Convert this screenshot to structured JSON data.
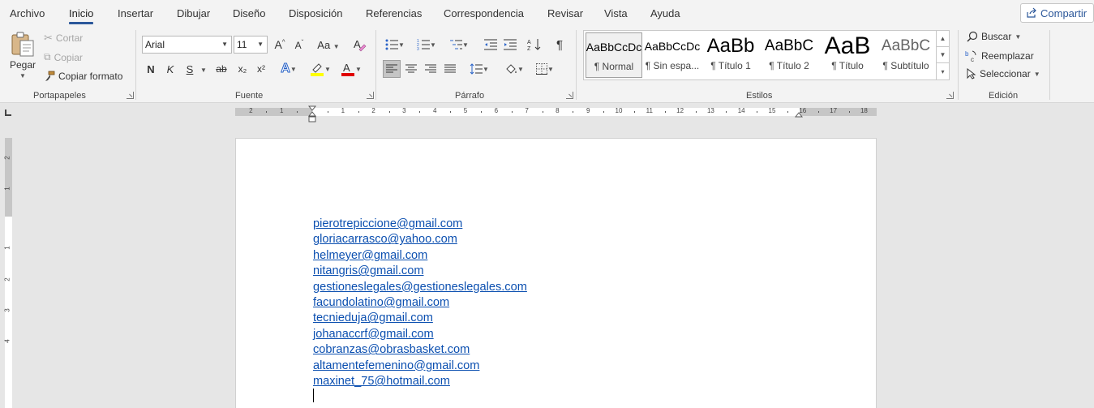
{
  "tabs": [
    {
      "label": "Archivo",
      "active": false
    },
    {
      "label": "Inicio",
      "active": true
    },
    {
      "label": "Insertar",
      "active": false
    },
    {
      "label": "Dibujar",
      "active": false
    },
    {
      "label": "Diseño",
      "active": false
    },
    {
      "label": "Disposición",
      "active": false
    },
    {
      "label": "Referencias",
      "active": false
    },
    {
      "label": "Correspondencia",
      "active": false
    },
    {
      "label": "Revisar",
      "active": false
    },
    {
      "label": "Vista",
      "active": false
    },
    {
      "label": "Ayuda",
      "active": false
    }
  ],
  "share_label": "Compartir",
  "clipboard": {
    "group_label": "Portapapeles",
    "paste": "Pegar",
    "cut": "Cortar",
    "copy": "Copiar",
    "format_painter": "Copiar formato"
  },
  "font": {
    "group_label": "Fuente",
    "font_name": "Arial",
    "font_size": "11",
    "bold": "N",
    "italic": "K",
    "underline": "S",
    "strikethrough": "ab",
    "subscript": "x₂",
    "superscript": "x²",
    "grow": "A^",
    "shrink": "Aˇ",
    "change_case": "Aa",
    "highlight_color": "#ffff00",
    "font_color": "#e00000"
  },
  "paragraph": {
    "group_label": "Párrafo",
    "show_marks": "¶",
    "active_alignment": "left"
  },
  "styles": {
    "group_label": "Estilos",
    "items": [
      {
        "sample": "AaBbCcDc",
        "name": "¶ Normal",
        "selected": true
      },
      {
        "sample": "AaBbCcDc",
        "name": "¶ Sin espa...",
        "selected": false
      },
      {
        "sample": "AaBb",
        "name": "¶ Título 1",
        "selected": false
      },
      {
        "sample": "AaBbC",
        "name": "¶ Título 2",
        "selected": false
      },
      {
        "sample": "AaB",
        "name": "¶ Título",
        "selected": false
      },
      {
        "sample": "AaBbC",
        "name": "¶ Subtítulo",
        "selected": false
      }
    ]
  },
  "editing": {
    "group_label": "Edición",
    "find": "Buscar",
    "replace": "Reemplazar",
    "select": "Seleccionar"
  },
  "ruler": {
    "left_numbers": [
      "2",
      "1"
    ],
    "right_numbers": [
      "1",
      "2",
      "3",
      "4",
      "5",
      "6",
      "7",
      "8",
      "9",
      "10",
      "11",
      "12",
      "13",
      "14",
      "15",
      "16",
      "17",
      "18"
    ],
    "vertical_numbers": [
      "2",
      "1",
      "1",
      "2",
      "3",
      "4"
    ]
  },
  "document": {
    "emails": [
      "pierotrepiccione@gmail.com",
      "gloriacarrasco@yahoo.com",
      "helmeyer@gmail.com",
      "nitangris@gmail.com",
      "gestioneslegales@gestioneslegales.com",
      "facundolatino@gmail.com",
      "tecnieduja@gmail.com",
      "johanaccrf@gmail.com",
      "cobranzas@obrasbasket.com",
      "altamentefemenino@gmail.com",
      "maxinet_75@hotmail.com"
    ]
  }
}
